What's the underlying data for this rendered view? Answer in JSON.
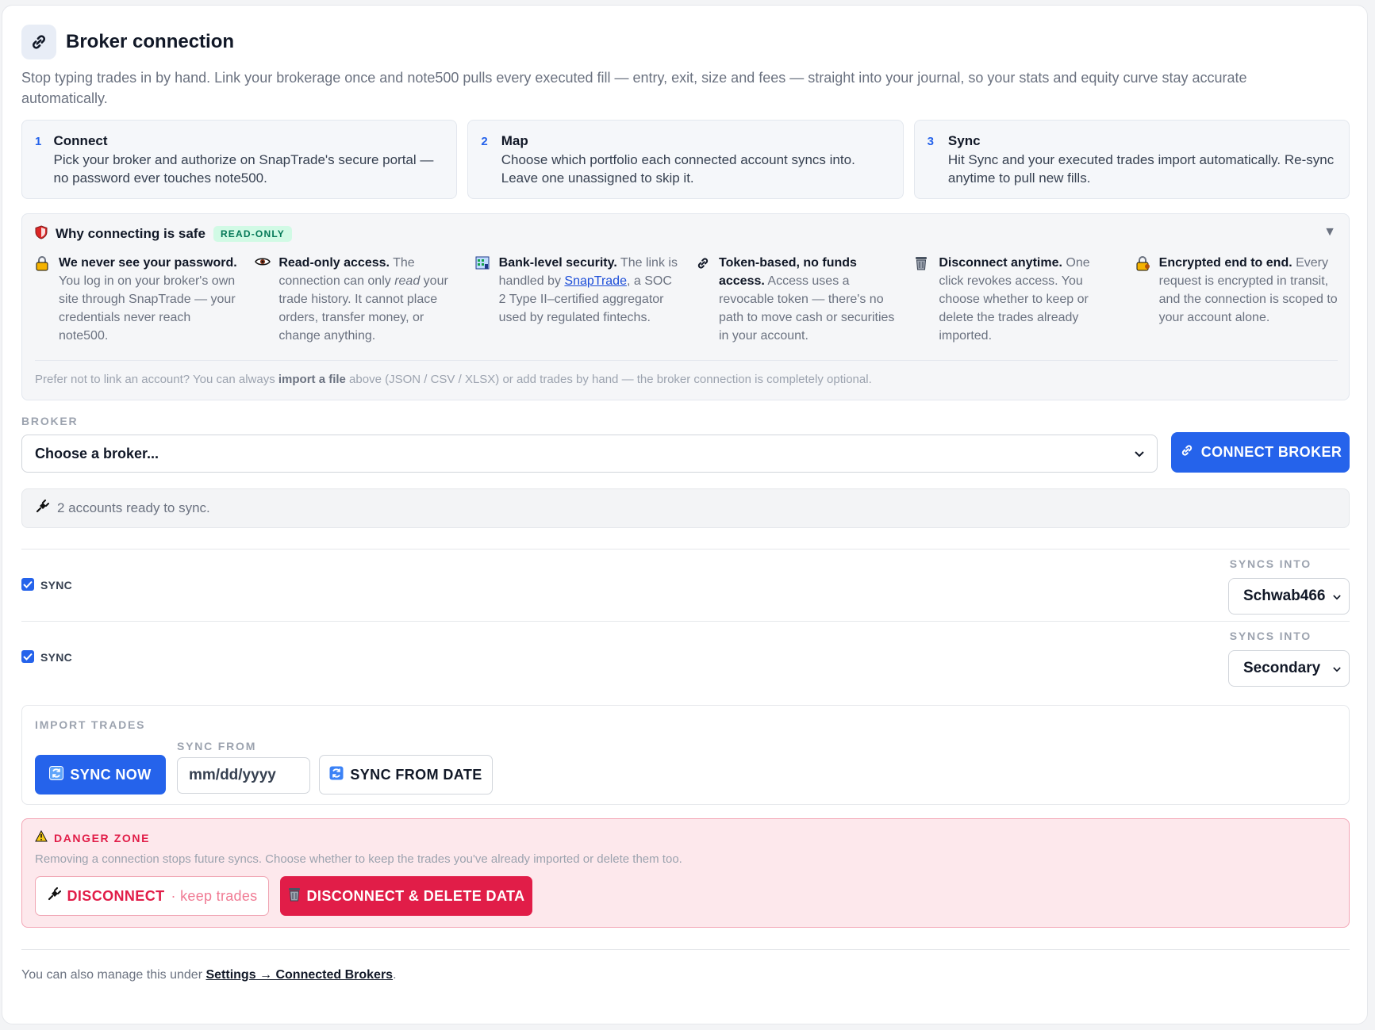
{
  "header": {
    "title": "Broker connection",
    "intro": "Stop typing trades in by hand. Link your brokerage once and note500 pulls every executed fill — entry, exit, size and fees — straight into your journal, so your stats and equity curve stay accurate automatically."
  },
  "steps": [
    {
      "num": "1",
      "title": "Connect",
      "desc": "Pick your broker and authorize on SnapTrade's secure portal — no password ever touches note500."
    },
    {
      "num": "2",
      "title": "Map",
      "desc": "Choose which portfolio each connected account syncs into. Leave one unassigned to skip it."
    },
    {
      "num": "3",
      "title": "Sync",
      "desc": "Hit Sync and your executed trades import automatically. Re-sync anytime to pull new fills."
    }
  ],
  "safety": {
    "title": "Why connecting is safe",
    "badge": "READ-ONLY",
    "features": [
      {
        "icon": "lock-icon",
        "bold": "We never see your password.",
        "text": " You log in on your broker's own site through SnapTrade — your credentials never reach note500."
      },
      {
        "icon": "eye-icon",
        "bold": "Read-only access.",
        "text_a": " The connection can only ",
        "em": "read",
        "text_b": " your trade history. It cannot place orders, transfer money, or change anything."
      },
      {
        "icon": "bank-icon",
        "bold": "Bank-level security.",
        "text_a": " The link is handled by ",
        "link": "SnapTrade",
        "text_b": ", a SOC 2 Type II–certified aggregator used by regulated fintechs."
      },
      {
        "icon": "link-icon",
        "bold": "Token-based, no funds access.",
        "text": " Access uses a revocable token — there's no path to move cash or securities in your account."
      },
      {
        "icon": "trash-icon",
        "bold": "Disconnect anytime.",
        "text": " One click revokes access. You choose whether to keep or delete the trades already imported."
      },
      {
        "icon": "lock-key-icon",
        "bold": "Encrypted end to end.",
        "text": " Every request is encrypted in transit, and the connection is scoped to your account alone."
      }
    ],
    "footer_a": "Prefer not to link an account? You can always ",
    "footer_bold": "import a file",
    "footer_b": " above (JSON / CSV / XLSX) or add trades by hand — the broker connection is completely optional."
  },
  "broker": {
    "label": "BROKER",
    "selected": "Choose a broker...",
    "connect_label": "CONNECT BROKER"
  },
  "status": {
    "text": "2 accounts ready to sync."
  },
  "accounts": [
    {
      "sync_label": "SYNC",
      "checked": true,
      "syncs_into_label": "SYNCS INTO",
      "portfolio": "Schwab466"
    },
    {
      "sync_label": "SYNC",
      "checked": true,
      "syncs_into_label": "SYNCS INTO",
      "portfolio": "Secondary"
    }
  ],
  "import": {
    "label": "IMPORT TRADES",
    "sync_now": "SYNC NOW",
    "sync_from_label": "SYNC FROM",
    "date_placeholder": "mm/dd/yyyy",
    "sync_from_date": "SYNC FROM DATE"
  },
  "danger": {
    "title": "DANGER ZONE",
    "desc": "Removing a connection stops future syncs. Choose whether to keep the trades you've already imported or delete them too.",
    "disconnect": "DISCONNECT",
    "keep_note": "· keep trades",
    "delete": "DISCONNECT & DELETE DATA"
  },
  "footer": {
    "text": "You can also manage this under ",
    "link": "Settings → Connected Brokers",
    "end": "."
  },
  "colors": {
    "accent": "#2563eb",
    "danger": "#e11d48",
    "safe_badge": "#047857"
  }
}
